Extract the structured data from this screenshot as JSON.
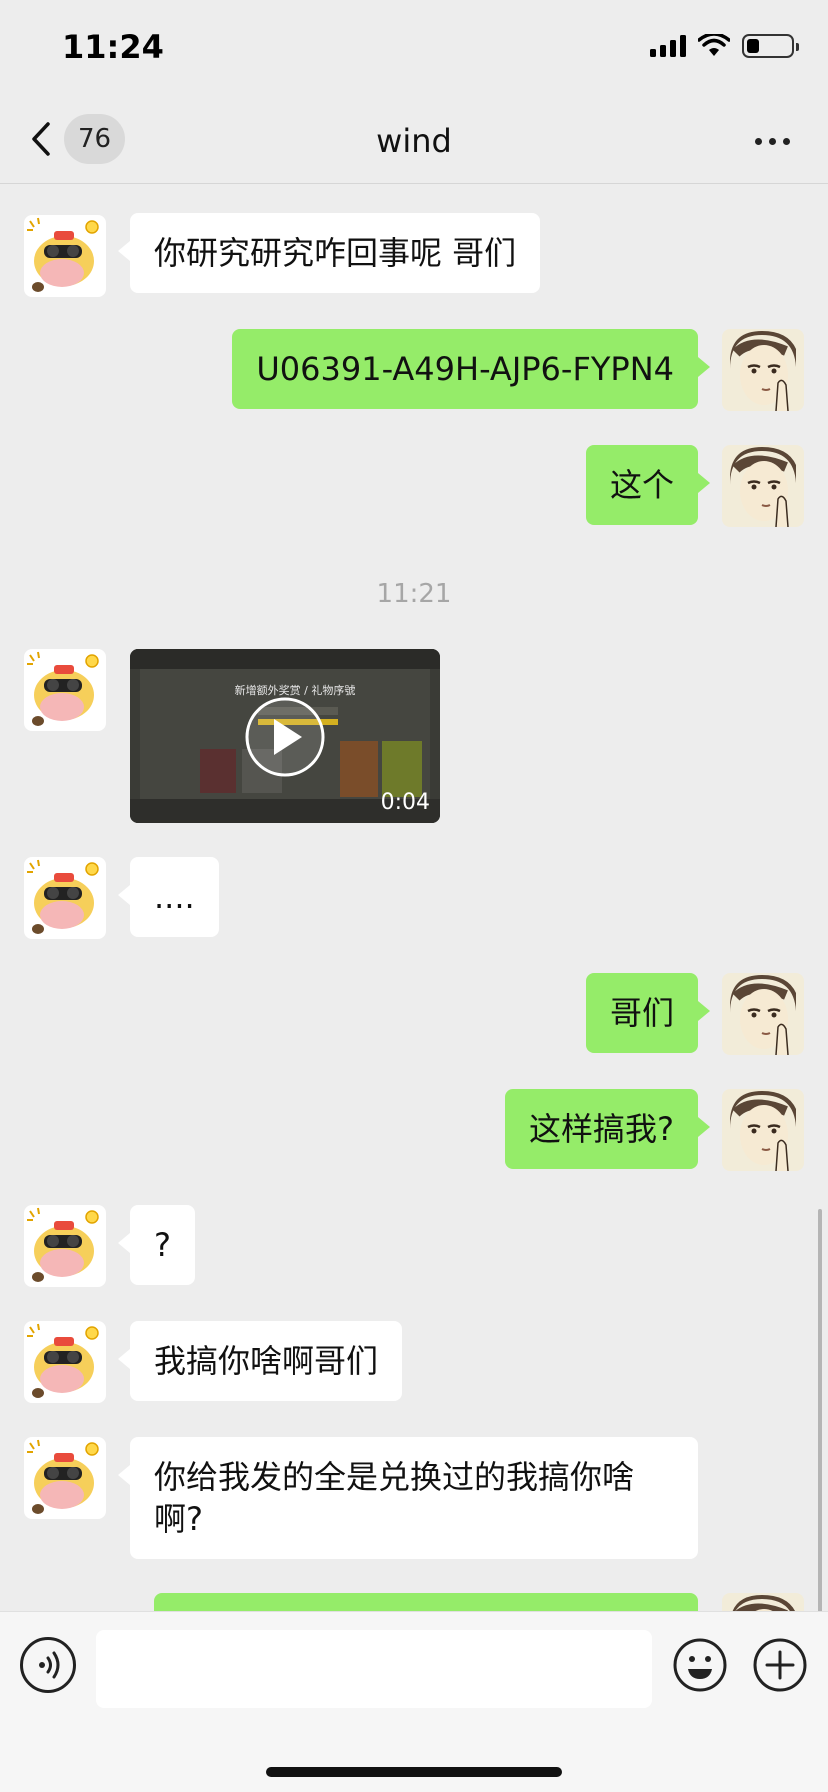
{
  "status_bar": {
    "time": "11:24",
    "battery_level": 0.28
  },
  "nav": {
    "unread_count": "76",
    "title": "wind"
  },
  "messages": [
    {
      "side": "in",
      "type": "text",
      "text": "你研究研究咋回事呢 哥们"
    },
    {
      "side": "out",
      "type": "text",
      "text": "U06391-A49H-AJP6-FYPN4"
    },
    {
      "side": "out",
      "type": "text",
      "text": "这个"
    },
    {
      "type": "timestamp",
      "text": "11:21"
    },
    {
      "side": "in",
      "type": "video",
      "duration": "0:04",
      "screen_title": "新增额外奖赏 / 礼物序號"
    },
    {
      "side": "in",
      "type": "text",
      "text": "...."
    },
    {
      "side": "out",
      "type": "text",
      "text": "哥们"
    },
    {
      "side": "out",
      "type": "text",
      "text": "这样搞我?"
    },
    {
      "side": "in",
      "type": "text",
      "text": "?"
    },
    {
      "side": "in",
      "type": "text",
      "text": "我搞你啥啊哥们"
    },
    {
      "side": "in",
      "type": "text",
      "text": "你给我发的全是兑换过的我搞你啥啊?"
    },
    {
      "side": "out",
      "type": "text",
      "text": ""
    }
  ],
  "input": {
    "placeholder": "",
    "value": ""
  },
  "icons": {
    "back": "chevron-left-icon",
    "more": "more-horizontal-icon",
    "voice": "voice-icon",
    "emoji": "emoji-icon",
    "plus": "plus-icon",
    "play": "play-icon"
  },
  "colors": {
    "background": "#ededed",
    "outgoing_bubble": "#95ec69",
    "incoming_bubble": "#ffffff",
    "timestamp": "#a6a6a6"
  }
}
